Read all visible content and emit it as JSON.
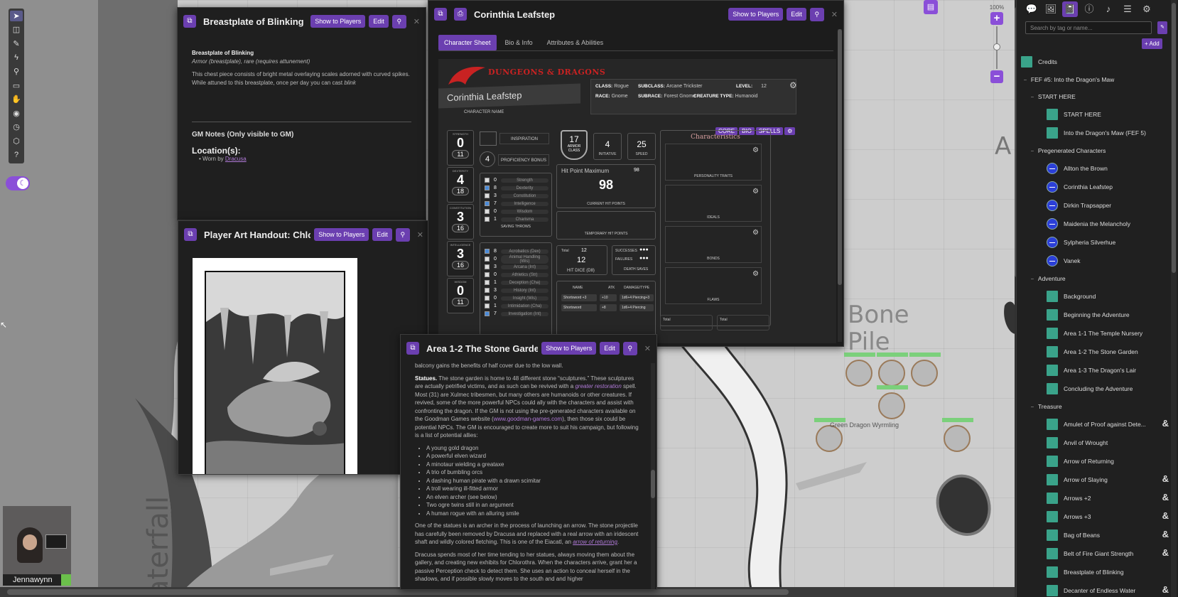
{
  "canvas": {
    "map_labels": {
      "bone_pile": "Bone\nPile",
      "waterfall": "aterfall",
      "edge_letter": "A"
    },
    "token_name": "Green Dragon Wyrmling",
    "zoom_percent": "100%"
  },
  "webcam": {
    "name": "Jennawynn"
  },
  "breastplate": {
    "title": "Breastplate of Blinking",
    "show_btn": "Show to Players",
    "edit_btn": "Edit",
    "name": "Breastplate of Blinking",
    "type": "Armor (breastplate), rare (requires attunement)",
    "desc_pre": "This chest piece consists of bright metal overlaying scales adorned with curved spikes. While attuned to this breastplate, once per day you can cast ",
    "desc_spell": "blink",
    "gm_notes": "GM Notes (Only visible to GM)",
    "location_heading": "Location(s):",
    "worn_by": "Worn by ",
    "worn_link": "Dracusa"
  },
  "handout": {
    "title": "Player Art Handout: Chlorothra",
    "show_btn": "Show to Players",
    "edit_btn": "Edit"
  },
  "charsheet": {
    "title": "Corinthia Leafstep",
    "show_btn": "Show to Players",
    "edit_btn": "Edit",
    "tabs": [
      "Character Sheet",
      "Bio & Info",
      "Attributes & Abilities"
    ],
    "logo": "DUNGEONS & DRAGONS",
    "char_name": "Corinthia Leafstep",
    "char_name_label": "CHARACTER NAME",
    "class_label": "CLASS:",
    "class": "Rogue",
    "subclass_label": "SUBCLASS:",
    "subclass": "Arcane Trickster",
    "level_label": "LEVEL:",
    "level": "12",
    "race_label": "RACE:",
    "race": "Gnome",
    "subrace_label": "SUBRACE:",
    "subrace": "Forest Gnome",
    "ctype_label": "CREATURE TYPE:",
    "ctype": "Humanoid",
    "pills": [
      "CORE",
      "BIO",
      "SPELLS"
    ],
    "abilities": [
      {
        "name": "STRENGTH",
        "mod": "0",
        "score": "11"
      },
      {
        "name": "DEXTERITY",
        "mod": "4",
        "score": "18"
      },
      {
        "name": "CONSTITUTION",
        "mod": "3",
        "score": "16"
      },
      {
        "name": "INTELLIGENCE",
        "mod": "3",
        "score": "16"
      },
      {
        "name": "WISDOM",
        "mod": "0",
        "score": "11"
      }
    ],
    "inspiration": "INSPIRATION",
    "prof_bonus": "4",
    "prof_label": "PROFICIENCY BONUS",
    "saves": [
      {
        "checked": false,
        "val": "0",
        "label": "Strength"
      },
      {
        "checked": true,
        "val": "8",
        "label": "Dexterity"
      },
      {
        "checked": false,
        "val": "3",
        "label": "Constitution"
      },
      {
        "checked": true,
        "val": "7",
        "label": "Intelligence"
      },
      {
        "checked": false,
        "val": "0",
        "label": "Wisdom"
      },
      {
        "checked": false,
        "val": "1",
        "label": "Charisma"
      }
    ],
    "saves_label": "SAVING THROWS",
    "skills": [
      {
        "checked": true,
        "val": "8",
        "label": "Acrobatics (Dex)"
      },
      {
        "checked": false,
        "val": "0",
        "label": "Animal Handling (Wis)"
      },
      {
        "checked": false,
        "val": "3",
        "label": "Arcana (Int)"
      },
      {
        "checked": false,
        "val": "0",
        "label": "Athletics (Str)"
      },
      {
        "checked": false,
        "val": "1",
        "label": "Deception (Cha)"
      },
      {
        "checked": false,
        "val": "3",
        "label": "History (Int)"
      },
      {
        "checked": false,
        "val": "0",
        "label": "Insight (Wis)"
      },
      {
        "checked": false,
        "val": "1",
        "label": "Intimidation (Cha)"
      },
      {
        "checked": true,
        "val": "7",
        "label": "Investigation (Int)"
      }
    ],
    "ac": "17",
    "ac_label": "ARMOR CLASS",
    "initiative": "4",
    "initiative_label": "INITIATIVE",
    "speed": "25",
    "speed_label": "SPEED",
    "hp_max_label": "Hit Point Maximum",
    "hp_max": "98",
    "hp_current": "98",
    "hp_current_label": "CURRENT HIT POINTS",
    "temp_hp_label": "TEMPORARY HIT POINTS",
    "hd_total_label": "Total",
    "hd_total": "12",
    "hd_current": "12",
    "hd_label": "HIT DICE",
    "hd_die": "(D8)",
    "ds_success": "SUCCESSES",
    "ds_fail": "FAILURES",
    "ds_label": "DEATH SAVES",
    "atk_headers": [
      "NAME",
      "ATK",
      "DAMAGE/TYPE"
    ],
    "attacks": [
      {
        "name": "Shortsword +3",
        "atk": "+10",
        "dmg": "1d6+4 Piercing+3"
      },
      {
        "name": "Shortsword",
        "atk": "+8",
        "dmg": "1d6+4 Piercing"
      }
    ],
    "characteristics_title": "Characteristics",
    "traits": [
      "PERSONALITY TRAITS",
      "IDEALS",
      "BONDS",
      "FLAWS"
    ],
    "total_label": "Total"
  },
  "stone": {
    "title": "Area 1-2 The Stone Garden",
    "show_btn": "Show to Players",
    "edit_btn": "Edit",
    "p0": "balcony gains the benefits of half cover due to the low wall.",
    "statues_bold": "Statues.",
    "p1_a": " The stone garden is home to 48 different stone “sculptures.” These sculptures are actually petrified victims, and as such can be revived with a ",
    "p1_link": "greater restoration",
    "p1_b": " spell. Most (31) are Xulmec tribesmen, but many others are humanoids or other creatures. If revived, some of the more powerful NPCs could ally with the characters and assist with confronting the dragon. If the GM is not using the pre-generated characters available on the Goodman Games website (",
    "p1_url": "www.goodman-games.com",
    "p1_c": "), then those six could be potential NPCs. The GM is encouraged to create more to suit his campaign, but following is a list of potential allies:",
    "allies": [
      "A young gold dragon",
      "A powerful elven wizard",
      "A minotaur wielding a greataxe",
      "A trio of bumbling orcs",
      "A dashing human pirate with a drawn scimitar",
      "A troll wearing ill-fitted armor",
      "An elven archer (see below)",
      "Two ogre twins still in an argument",
      "A human rogue with an alluring smile"
    ],
    "p2_a": "One of the statues is an archer in the process of launching an arrow. The stone projectile has carefully been removed by Dracusa and replaced with a real arrow with an iridescent shaft and wildly colored fletching. This is one of the Eiacatl, an ",
    "p2_link": "arrow of returning",
    "p2_b": ".",
    "p3": "Dracusa spends most of her time tending to her statues, always moving them about the gallery, and creating new exhibits for Chlorothra. When the characters arrive, grant her a passive Perception check to detect them. She uses an action to conceal herself in the shadows, and if possible slowly moves to the south and and higher"
  },
  "sidebar": {
    "search_placeholder": "Search by tag or name...",
    "add_btn": "+ Add",
    "rows": [
      {
        "kind": "handout",
        "indent": 0,
        "label": "Credits"
      },
      {
        "kind": "folder",
        "indent": 0,
        "label": "FEF #5: Into the Dragon's Maw"
      },
      {
        "kind": "folder",
        "indent": 1,
        "label": "START HERE"
      },
      {
        "kind": "handout",
        "indent": 2,
        "label": "START HERE"
      },
      {
        "kind": "handout",
        "indent": 2,
        "label": "Into the Dragon's Maw (FEF 5)"
      },
      {
        "kind": "folder",
        "indent": 1,
        "label": "Pregenerated Characters"
      },
      {
        "kind": "char",
        "indent": 2,
        "label": "Allton the Brown"
      },
      {
        "kind": "char",
        "indent": 2,
        "label": "Corinthia Leafstep"
      },
      {
        "kind": "char",
        "indent": 2,
        "label": "Dirkin Trapsapper"
      },
      {
        "kind": "char",
        "indent": 2,
        "label": "Maidenia the Melancholy"
      },
      {
        "kind": "char",
        "indent": 2,
        "label": "Sylpheria Silverhue"
      },
      {
        "kind": "char",
        "indent": 2,
        "label": "Vanek"
      },
      {
        "kind": "folder",
        "indent": 1,
        "label": "Adventure"
      },
      {
        "kind": "handout",
        "indent": 2,
        "label": "Background"
      },
      {
        "kind": "handout",
        "indent": 2,
        "label": "Beginning the Adventure"
      },
      {
        "kind": "handout",
        "indent": 2,
        "label": "Area 1-1 The Temple Nursery"
      },
      {
        "kind": "handout",
        "indent": 2,
        "label": "Area 1-2 The Stone Garden"
      },
      {
        "kind": "handout",
        "indent": 2,
        "label": "Area 1-3 The Dragon's Lair"
      },
      {
        "kind": "handout",
        "indent": 2,
        "label": "Concluding the Adventure"
      },
      {
        "kind": "folder",
        "indent": 1,
        "label": "Treasure"
      },
      {
        "kind": "item",
        "indent": 2,
        "label": "Amulet of Proof against Dete..."
      },
      {
        "kind": "handout",
        "indent": 2,
        "label": "Anvil of Wrought"
      },
      {
        "kind": "handout",
        "indent": 2,
        "label": "Arrow of Returning"
      },
      {
        "kind": "item",
        "indent": 2,
        "label": "Arrow of Slaying"
      },
      {
        "kind": "item",
        "indent": 2,
        "label": "Arrows +2"
      },
      {
        "kind": "item",
        "indent": 2,
        "label": "Arrows +3"
      },
      {
        "kind": "item",
        "indent": 2,
        "label": "Bag of Beans"
      },
      {
        "kind": "item",
        "indent": 2,
        "label": "Belt of Fire Giant Strength"
      },
      {
        "kind": "handout",
        "indent": 2,
        "label": "Breastplate of Blinking"
      },
      {
        "kind": "item",
        "indent": 2,
        "label": "Decanter of Endless Water"
      }
    ]
  }
}
